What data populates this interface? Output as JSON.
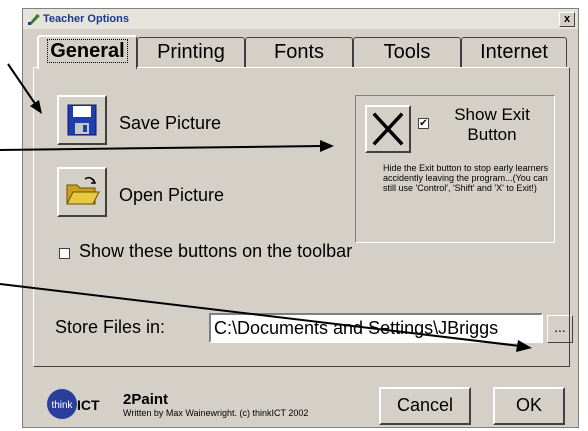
{
  "window": {
    "title": "Teacher Options",
    "close_label": "x"
  },
  "tabs": [
    {
      "label": "General"
    },
    {
      "label": "Printing"
    },
    {
      "label": "Fonts"
    },
    {
      "label": "Tools"
    },
    {
      "label": "Internet"
    }
  ],
  "general": {
    "save_label": "Save Picture",
    "open_label": "Open Picture",
    "show_exit_label": "Show Exit Button",
    "show_exit_checked": true,
    "exit_description": "Hide the Exit button to stop early learners accidently leaving the program...(You can still use 'Control', 'Shift' and 'X' to Exit!)",
    "show_toolbar_label": "Show these buttons on the toolbar",
    "show_toolbar_checked": false,
    "store_files_label": "Store Files in:",
    "store_files_value": "C:\\Documents and Settings\\JBriggs",
    "browse_label": "..."
  },
  "footer": {
    "logo_think": "think",
    "logo_ict": "ICT",
    "app_name": "2Paint",
    "credit": "Written by Max Wainewright. (c) thinkICT 2002",
    "cancel_label": "Cancel",
    "ok_label": "OK"
  },
  "icons": {
    "title": "paint-app-icon",
    "save": "floppy-disk-icon",
    "open": "open-folder-icon",
    "exit": "x-icon"
  },
  "colors": {
    "dialog_bg": "#d4d0c8",
    "title_text": "#1a3a8a",
    "floppy": "#1f3fb0",
    "folder": "#e8c840",
    "logo_think": "#2a3f9c"
  }
}
